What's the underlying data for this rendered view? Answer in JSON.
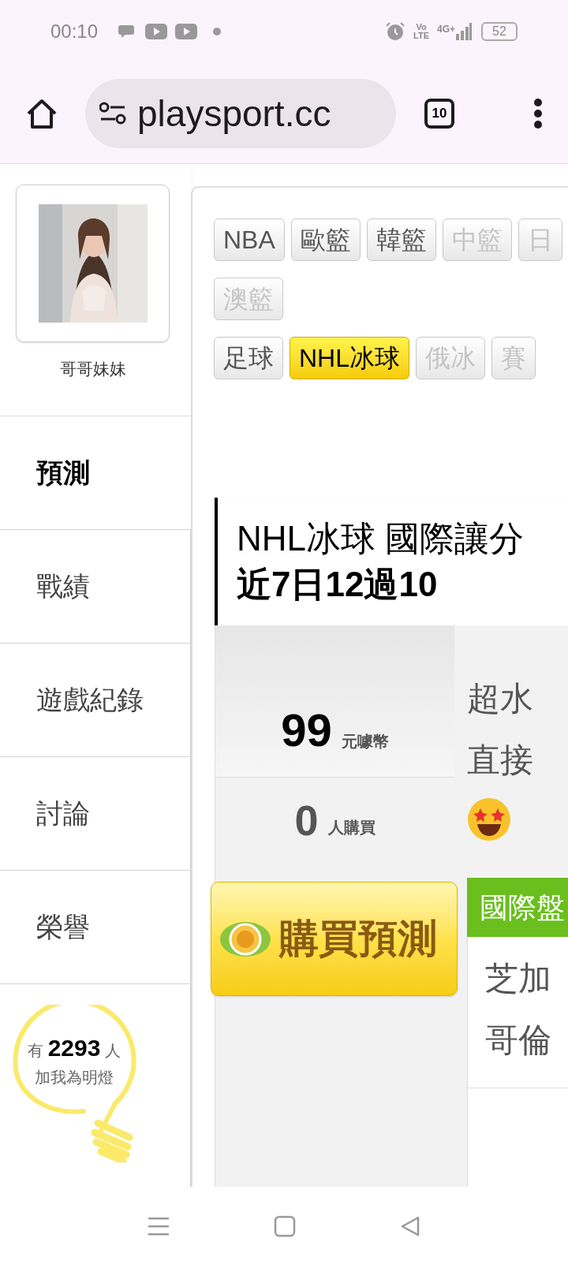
{
  "status_bar": {
    "time": "00:10",
    "volte": [
      "Vo",
      "LTE"
    ],
    "network": "4G+",
    "battery": "52"
  },
  "browser": {
    "url": "playsport.cc",
    "tab_count": "10"
  },
  "profile": {
    "name": "哥哥妹妹"
  },
  "sidebar": {
    "items": [
      {
        "label": "預測",
        "selected": true
      },
      {
        "label": "戰績",
        "selected": false
      },
      {
        "label": "遊戲紀錄",
        "selected": false
      },
      {
        "label": "討論",
        "selected": false
      },
      {
        "label": "榮譽",
        "selected": false
      }
    ]
  },
  "lamp": {
    "prefix": "有",
    "count": "2293",
    "suffix": "人",
    "caption": "加我為明燈"
  },
  "sport_tags": {
    "rows": [
      [
        {
          "label": "NBA",
          "selected": false,
          "disabled": false
        },
        {
          "label": "歐籃",
          "selected": false,
          "disabled": false
        },
        {
          "label": "韓籃",
          "selected": false,
          "disabled": false
        },
        {
          "label": "中籃",
          "selected": false,
          "disabled": true
        },
        {
          "label": "日",
          "selected": false,
          "disabled": true
        }
      ],
      [
        {
          "label": "澳籃",
          "selected": false,
          "disabled": true
        }
      ],
      [
        {
          "label": "足球",
          "selected": false,
          "disabled": false
        },
        {
          "label": "NHL冰球",
          "selected": true,
          "disabled": false
        },
        {
          "label": "俄冰",
          "selected": false,
          "disabled": true
        },
        {
          "label": "賽",
          "selected": false,
          "disabled": true
        }
      ]
    ]
  },
  "prediction": {
    "title": "NHL冰球 國際讓分",
    "record": "近7日12過10",
    "price": "99",
    "price_unit": "元噱幣",
    "buyers": "0",
    "buyers_unit": "人購買",
    "description_lines": [
      "超水",
      "直接"
    ],
    "buy_button": "購買預測",
    "market_tab": "國際盤",
    "teams": [
      "芝加",
      "哥倫"
    ]
  }
}
